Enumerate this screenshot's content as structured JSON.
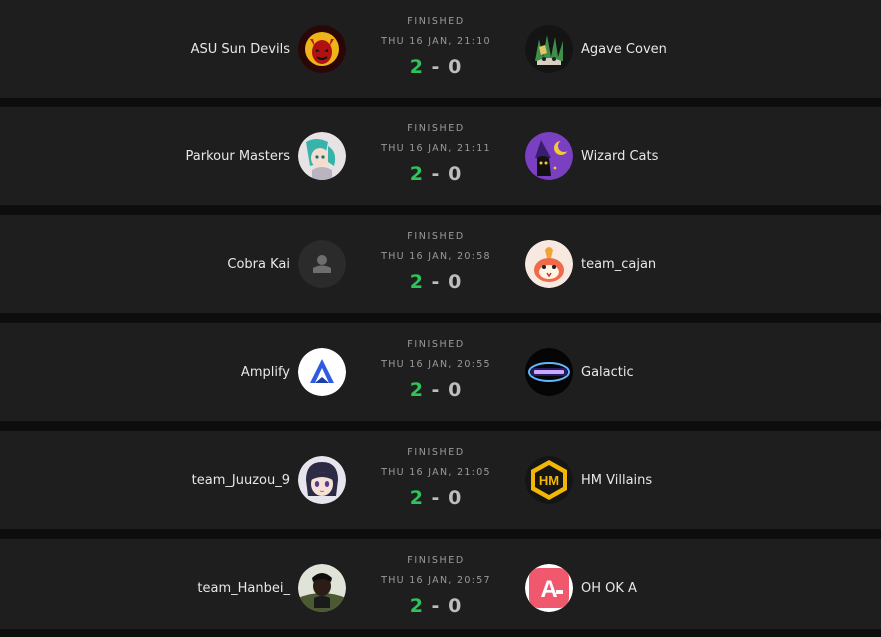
{
  "matches": [
    {
      "team1": "ASU Sun Devils",
      "team2": "Agave Coven",
      "status": "FINISHED",
      "time": "THU 16 JAN, 21:10",
      "score1": "2",
      "score2": "0",
      "sep": "-",
      "icon1": "devil-logo-icon",
      "icon2": "agave-logo-icon"
    },
    {
      "team1": "Parkour Masters",
      "team2": "Wizard Cats",
      "status": "FINISHED",
      "time": "THU 16 JAN, 21:11",
      "score1": "2",
      "score2": "0",
      "sep": "-",
      "icon1": "anime-character-avatar-icon",
      "icon2": "wizard-cat-logo-icon"
    },
    {
      "team1": "Cobra Kai",
      "team2": "team_cajan",
      "status": "FINISHED",
      "time": "THU 16 JAN, 20:58",
      "score1": "2",
      "score2": "0",
      "sep": "-",
      "icon1": "default-user-icon",
      "icon2": "cartoon-creature-icon"
    },
    {
      "team1": "Amplify",
      "team2": "Galactic",
      "status": "FINISHED",
      "time": "THU 16 JAN, 20:55",
      "score1": "2",
      "score2": "0",
      "sep": "-",
      "icon1": "amplify-logo-icon",
      "icon2": "galactic-logo-icon"
    },
    {
      "team1": "team_Juuzou_9",
      "team2": "HM Villains",
      "status": "FINISHED",
      "time": "THU 16 JAN, 21:05",
      "score1": "2",
      "score2": "0",
      "sep": "-",
      "icon1": "anime-girl-avatar-icon",
      "icon2": "hm-villains-logo-icon"
    },
    {
      "team1": "team_Hanbei_",
      "team2": "OH OK A",
      "status": "FINISHED",
      "time": "THU 16 JAN, 20:57",
      "score1": "2",
      "score2": "0",
      "sep": "-",
      "icon1": "person-photo-avatar-icon",
      "icon2": "oh-ok-a-logo-icon"
    }
  ],
  "colors": {
    "background": "#0d0d0d",
    "card": "#1e1e1e",
    "win_score": "#2ec45a",
    "lose_score": "#bdbdbd",
    "muted_text": "#9a9a9a"
  }
}
